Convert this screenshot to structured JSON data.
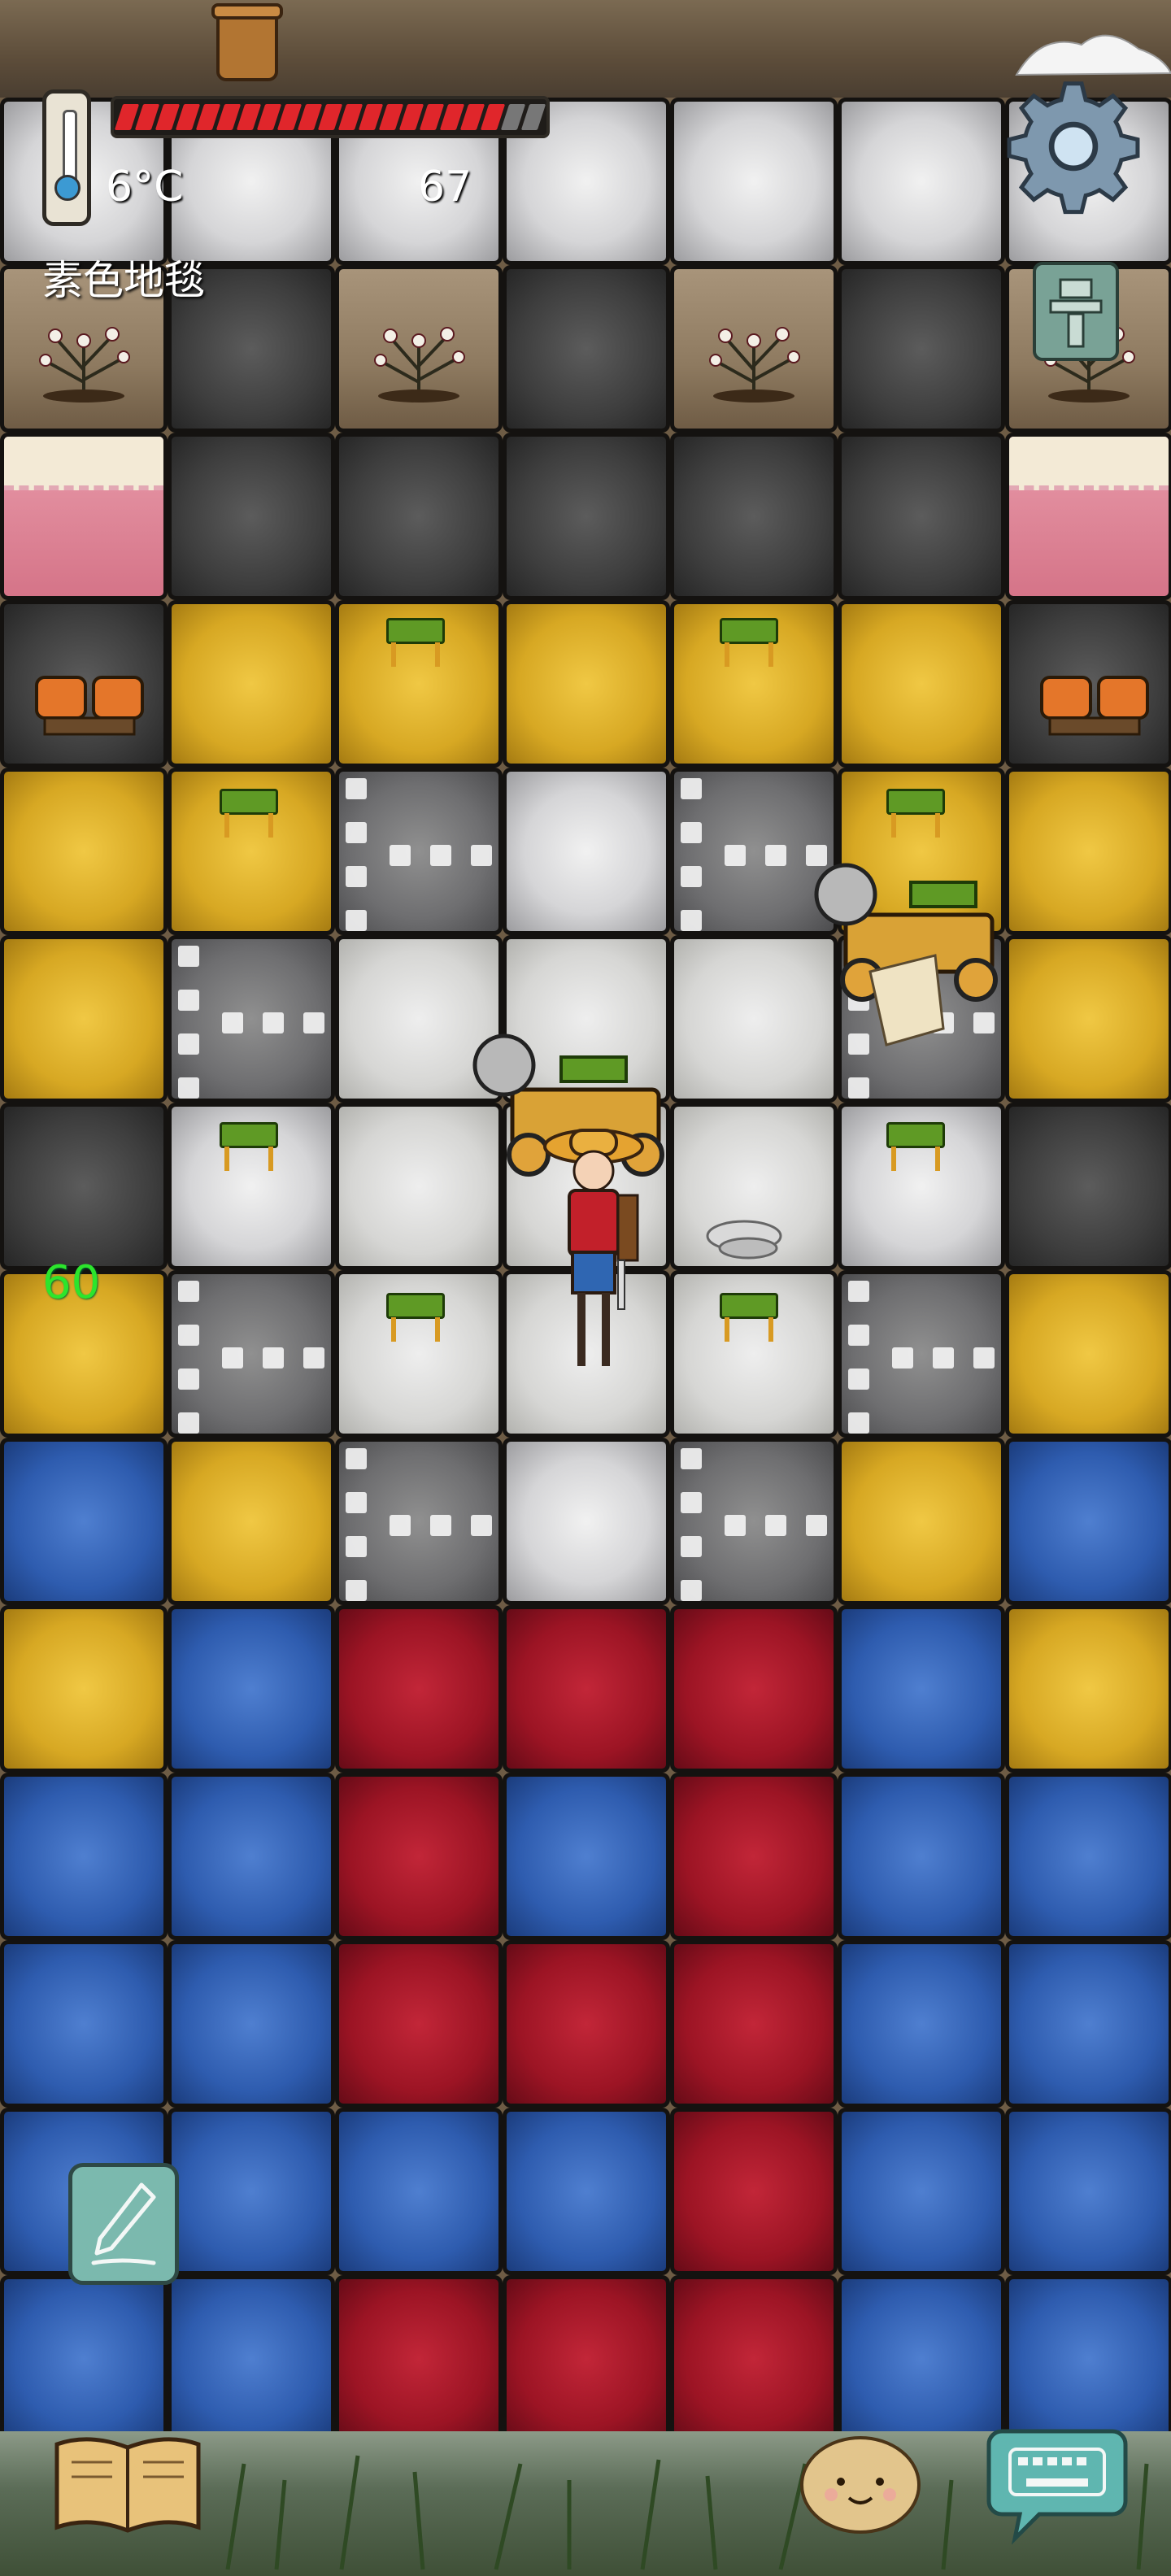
{
  "hud": {
    "temperature": "6°C",
    "food": "67",
    "held_item": "素色地毯",
    "age": "60",
    "health_segments_filled": 19,
    "health_segments_total": 21
  },
  "icons": {
    "thermometer": "thermometer-icon",
    "settings": "gear-icon",
    "pencil": "pencil-icon",
    "tech_tree": "tech-tree-icon",
    "book": "book-icon",
    "emote": "potato-face-icon",
    "chat": "keyboard-icon"
  },
  "colors": {
    "health": "#e0262b",
    "age": "#2ce52c",
    "yellow_rug": "#d7a823",
    "blue_rug": "#2e5caf",
    "red_rug": "#9c1424"
  }
}
